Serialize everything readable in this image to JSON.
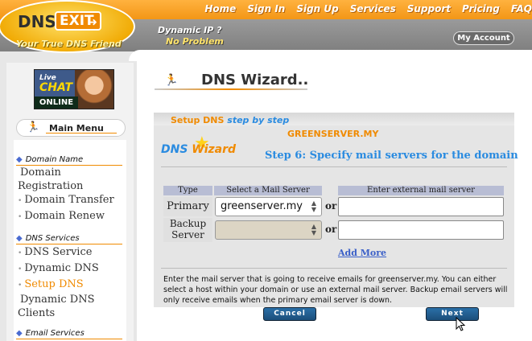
{
  "header": {
    "nav": [
      "Home",
      "Sign In",
      "Sign Up",
      "Services",
      "Support",
      "Pricing",
      "FAQ"
    ],
    "logo_dns": "DNS",
    "logo_exit": "EXIT",
    "tagline": "Your True DNS Friend",
    "dynamic_ip": "Dynamic IP ?",
    "no_problem": "No Problem",
    "my_account": "My Account"
  },
  "livechat": {
    "line1": "Live",
    "line2": "CHAT",
    "line3": "ONLINE"
  },
  "menu": {
    "title": "Main Menu",
    "sections": [
      {
        "title": "Domain Name",
        "items": [
          "Domain Registration",
          "Domain Transfer",
          "Domain Renew"
        ]
      },
      {
        "title": "DNS Services",
        "items": [
          "DNS Service",
          "Dynamic DNS",
          "Setup DNS",
          "Dynamic DNS Clients"
        ]
      },
      {
        "title": "Email Services",
        "items": []
      }
    ],
    "active_item": "Setup DNS"
  },
  "page": {
    "title": "DNS Wizard..",
    "tab_label": "Setup DNS",
    "tab_sub": "step by step",
    "hostname": "GREENSERVER.MY",
    "wizard_logo_dns": "DNS",
    "wizard_logo_wizard": "Wizard",
    "step_title": "Step 6: Specify mail servers for the domain"
  },
  "table": {
    "headers": [
      "Type",
      "Select a Mail Server",
      "Enter external mail server"
    ],
    "rows": [
      {
        "type": "Primary",
        "selected": "greenserver.my",
        "or": "or",
        "external": ""
      },
      {
        "type": "Backup Server",
        "selected": "",
        "or": "or",
        "external": ""
      }
    ],
    "add_more": "Add More"
  },
  "help_text": "Enter the mail server that is going to receive emails for greenserver.my. You can either select a host within your domain or use an external mail server. Backup email servers will only receive emails when the primary email server is down.",
  "buttons": {
    "cancel": "Cancel",
    "next": "Next"
  },
  "colors": {
    "accent": "#f08a00",
    "link": "#2a8be0",
    "button": "#1c4f7a"
  }
}
